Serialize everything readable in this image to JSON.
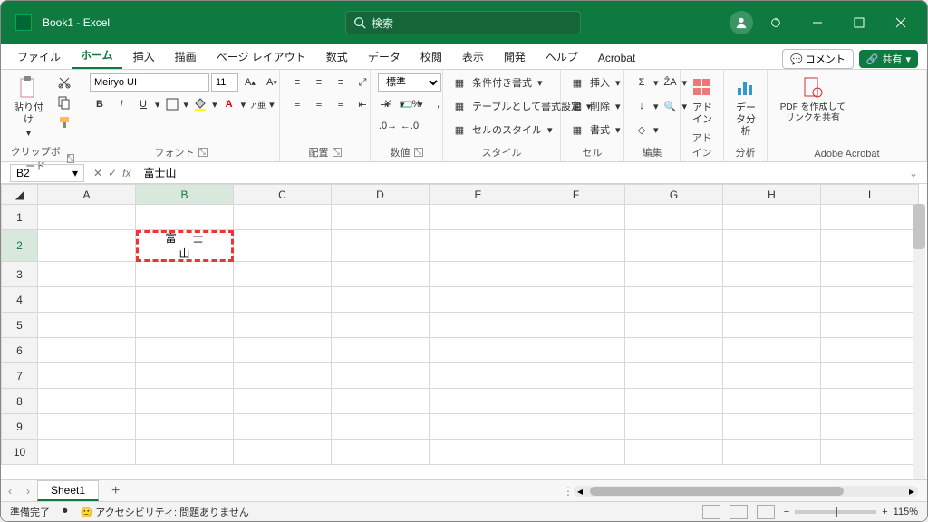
{
  "title": "Book1 - Excel",
  "search": {
    "placeholder": "検索"
  },
  "tabs": {
    "items": [
      "ファイル",
      "ホーム",
      "挿入",
      "描画",
      "ページ レイアウト",
      "数式",
      "データ",
      "校閲",
      "表示",
      "開発",
      "ヘルプ",
      "Acrobat"
    ],
    "active": 1
  },
  "topright": {
    "comment": "コメント",
    "share": "共有"
  },
  "ribbon": {
    "clipboard": {
      "label": "クリップボード",
      "paste": "貼り付け"
    },
    "font": {
      "label": "フォント",
      "name": "Meiryo UI",
      "size": "11",
      "bold": "B",
      "italic": "I",
      "underline": "U"
    },
    "align": {
      "label": "配置"
    },
    "number": {
      "label": "数値",
      "format": "標準"
    },
    "styles": {
      "label": "スタイル",
      "cond": "条件付き書式",
      "table": "テーブルとして書式設定",
      "cell": "セルのスタイル"
    },
    "cells": {
      "label": "セル",
      "insert": "挿入",
      "delete": "削除",
      "format": "書式"
    },
    "editing": {
      "label": "編集"
    },
    "addin": {
      "label": "アドイン",
      "btn": "アドイン"
    },
    "analysis": {
      "label": "分析",
      "btn": "データ分析"
    },
    "acrobat": {
      "label": "Adobe Acrobat",
      "btn": "PDF を作成してリンクを共有"
    }
  },
  "formula": {
    "cellref": "B2",
    "value": "富士山"
  },
  "grid": {
    "cols": [
      "A",
      "B",
      "C",
      "D",
      "E",
      "F",
      "G",
      "H",
      "I"
    ],
    "rows": [
      "1",
      "2",
      "3",
      "4",
      "5",
      "6",
      "7",
      "8",
      "9",
      "10"
    ],
    "activeRow": "2",
    "activeCol": "B",
    "b2": "富士山"
  },
  "sheet": {
    "name": "Sheet1"
  },
  "status": {
    "ready": "準備完了",
    "acc": "アクセシビリティ: 問題ありません",
    "zoom": "115%"
  }
}
